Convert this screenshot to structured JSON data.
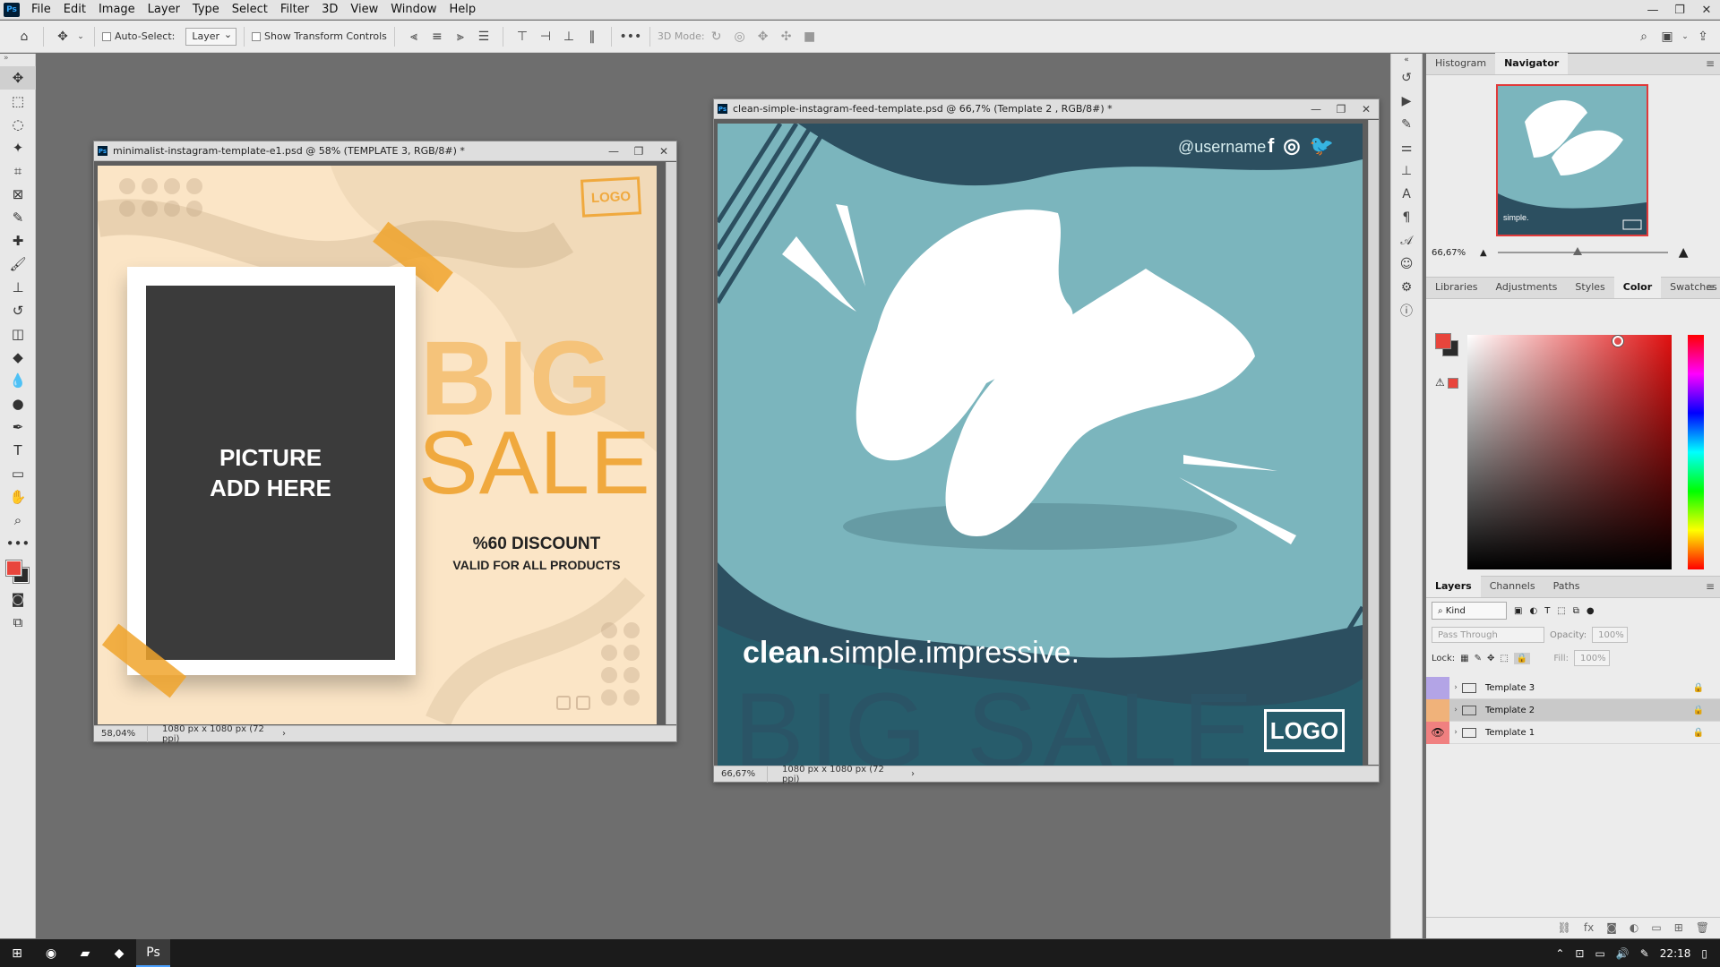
{
  "app": {
    "logo": "Ps"
  },
  "menu": [
    "File",
    "Edit",
    "Image",
    "Layer",
    "Type",
    "Select",
    "Filter",
    "3D",
    "View",
    "Window",
    "Help"
  ],
  "window_controls": {
    "minimize": "—",
    "restore": "❐",
    "close": "✕"
  },
  "options_bar": {
    "auto_select_label": "Auto-Select:",
    "auto_select_target": "Layer",
    "show_transform_label": "Show Transform Controls",
    "mode_3d_label": "3D Mode:"
  },
  "doc1": {
    "title": "minimalist-instagram-template-e1.psd @ 58% (TEMPLATE 3, RGB/8#) *",
    "zoom": "58,04%",
    "info": "1080 px x 1080 px (72 ppi)",
    "logo": "LOGO",
    "picture_line1": "PICTURE",
    "picture_line2": "ADD HERE",
    "big": "BIG",
    "sale": "SALE",
    "discount": "%60 DISCOUNT",
    "valid": "VALID FOR ALL PRODUCTS"
  },
  "doc2": {
    "title": "clean-simple-instagram-feed-template.psd @ 66,7% (Template 2 , RGB/8#) *",
    "zoom": "66,67%",
    "info": "1080 px x 1080 px (72 ppi)",
    "username": "@username",
    "social_f": "f",
    "social_ig": "◎",
    "social_tw": "🐦",
    "tagline_bold": "clean.",
    "tagline_mid": "simple.",
    "tagline_rest": "impressive.",
    "big_sale": "BIG SALE",
    "logo": "LOGO"
  },
  "navigator": {
    "tabs": [
      "Histogram",
      "Navigator"
    ],
    "active_tab": "Navigator",
    "zoom": "66,67%"
  },
  "color_panel": {
    "tabs": [
      "Libraries",
      "Adjustments",
      "Styles",
      "Color",
      "Swatches"
    ],
    "active_tab": "Color",
    "foreground": "#e8453c",
    "background": "#2b2b2b"
  },
  "layers_panel": {
    "tabs": [
      "Layers",
      "Channels",
      "Paths"
    ],
    "active_tab": "Layers",
    "filter_kind": "Kind",
    "blend_mode": "Pass Through",
    "opacity_label": "Opacity:",
    "opacity": "100%",
    "lock_label": "Lock:",
    "fill_label": "Fill:",
    "fill": "100%",
    "layers": [
      {
        "name": "Template 3",
        "color": "#b3a4e6",
        "visible": false
      },
      {
        "name": "Template 2",
        "color": "#f0b27a",
        "visible": false,
        "selected": true
      },
      {
        "name": "Template 1",
        "color": "#f08080",
        "visible": true
      }
    ]
  },
  "taskbar": {
    "time": "22:18"
  },
  "colors": {
    "accent_orange": "#f0a93e",
    "teal": "#7bb5bd",
    "dark_teal": "#2c4f60"
  }
}
